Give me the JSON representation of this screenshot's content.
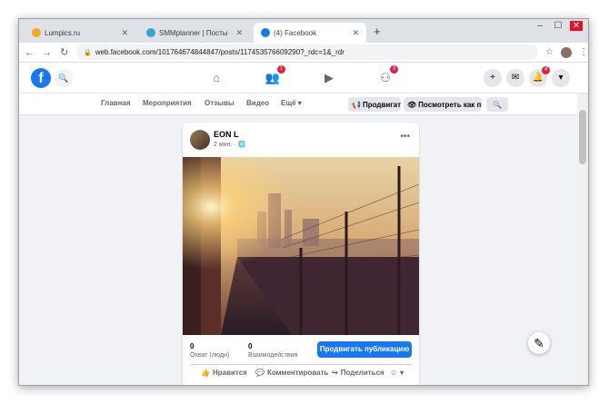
{
  "browser": {
    "tabs": [
      {
        "title": "Lumpics.ru",
        "color": "#f5a623"
      },
      {
        "title": "SMMplanner | Посты",
        "color": "#2ea6d8"
      },
      {
        "title": "(4) Facebook",
        "color": "#1877f2"
      }
    ],
    "url": "web.facebook.com/101764674844847/posts/117453576609290?_rdc=1&_rdr",
    "new_tab": "+"
  },
  "facebook": {
    "logo": "f",
    "badges": {
      "friends": "1",
      "groups": "3",
      "notifications": "4"
    },
    "page_nav": [
      "Главная",
      "Мероприятия",
      "Отзывы",
      "Видео",
      "Ещё ▾"
    ],
    "promote_label": "Продвигать",
    "view_as_label": "Посмотреть как п..."
  },
  "post": {
    "author": "EON L",
    "time": "2 мин. · ",
    "reach_value": "0",
    "reach_label": "Охват (люди)",
    "engagement_value": "0",
    "engagement_label": "Взаимодействия",
    "promote_post": "Продвигать публикацию",
    "actions": {
      "like": "Нравится",
      "comment": "Комментировать",
      "share": "Поделиться"
    }
  },
  "colors": {
    "brand": "#1877f2",
    "badge": "#e41e3f",
    "background": "#f0f2f5"
  }
}
